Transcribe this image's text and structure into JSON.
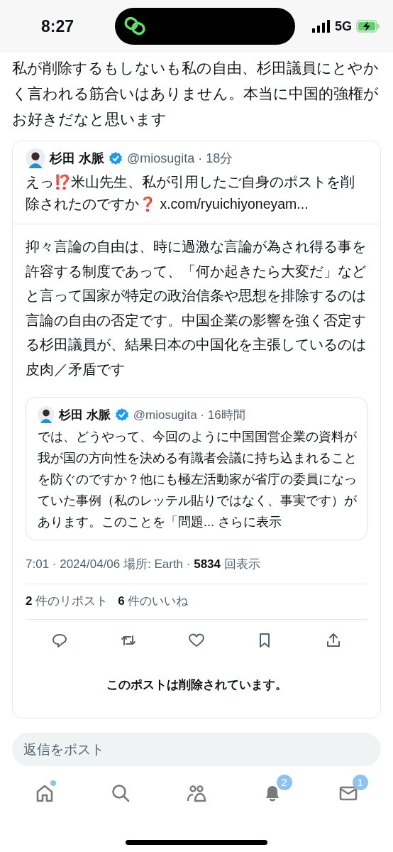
{
  "status_bar": {
    "time": "8:27",
    "network": "5G",
    "charging": true
  },
  "post": {
    "text": "私が削除するもしないも私の自由、杉田議員にとやかく言われる筋合いはありません。本当に中国的強権がお好きだなと思います"
  },
  "quoted_post": {
    "author": "杉田 水脈",
    "verified": true,
    "handle": "@miosugita",
    "time": "· 18分",
    "text": "えっ⁉️米山先生、私が引用したご自身のポストを削除されたのですか❓",
    "link": "x.com/ryuichiyoneyam..."
  },
  "reply": {
    "text": "抑々言論の自由は、時に過激な言論が為され得る事を許容する制度であって、「何か起きたら大変だ」などと言って国家が特定の政治信条や思想を排除するのは言論の自由の否定です。中国企業の影響を強く否定する杉田議員が、結果日本の中国化を主張しているのは皮肉／矛盾です",
    "quote": {
      "author": "杉田 水脈",
      "verified": true,
      "handle": "@miosugita",
      "time": "· 16時間",
      "text": "では、どうやって、今回のように中国国営企業の資料が我が国の方向性を決める有識者会議に持ち込まれることを防ぐのですか？他にも極左活動家が省庁の委員になっていた事例（私のレッテル貼りではなく、事実です）があります。このことを「問題...",
      "more": "さらに表示"
    },
    "meta": "7:01 · 2024/04/06 場所: Earth · **5834** 回表示",
    "stats": [
      "**2** 件のリポスト",
      "**6** 件のいいね"
    ],
    "actions": [
      {
        "kind": "reply"
      },
      {
        "kind": "repost"
      },
      {
        "kind": "like"
      },
      {
        "kind": "bookmark"
      },
      {
        "kind": "share"
      }
    ],
    "notice": "このポストは削除されています。"
  },
  "reply_field": {
    "placeholder": "返信をポスト"
  },
  "tab_bar": [
    {
      "kind": "home",
      "dot": true
    },
    {
      "kind": "search",
      "dot": false
    },
    {
      "kind": "communities",
      "dot": false
    },
    {
      "kind": "notifications",
      "dot": false,
      "badge": "2"
    },
    {
      "kind": "messages",
      "dot": false,
      "badge": "1"
    }
  ]
}
